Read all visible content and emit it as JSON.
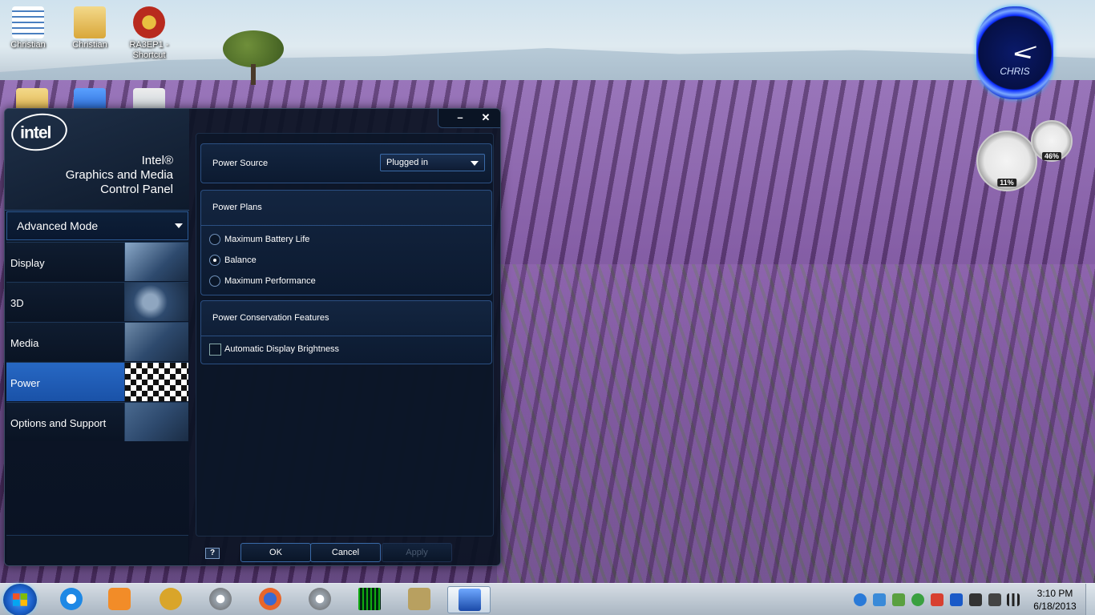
{
  "desktop": {
    "icons": [
      {
        "label": "Christian",
        "color": "#4a7fc0"
      },
      {
        "label": "Christian",
        "color": "#e8c660"
      },
      {
        "label": "RA3EP1 - Shortcut",
        "color": "#b82a1e"
      }
    ]
  },
  "gadgets": {
    "clock_name": "CHRIS",
    "cpu_percent": "11%",
    "mem_percent": "46%"
  },
  "window": {
    "brand": {
      "logo_text": "intel",
      "title_line1": "Intel®",
      "title_line2": "Graphics and Media",
      "title_line3": "Control Panel"
    },
    "mode": "Advanced Mode",
    "nav": [
      {
        "label": "Display",
        "active": false
      },
      {
        "label": "3D",
        "active": false
      },
      {
        "label": "Media",
        "active": false
      },
      {
        "label": "Power",
        "active": true
      },
      {
        "label": "Options and Support",
        "active": false
      }
    ],
    "titlebar": {
      "minimize": "–",
      "close": "✕"
    },
    "power_source": {
      "label": "Power Source",
      "value": "Plugged in"
    },
    "power_plans": {
      "heading": "Power Plans",
      "options": [
        {
          "label": "Maximum Battery Life",
          "selected": false
        },
        {
          "label": "Balance",
          "selected": true
        },
        {
          "label": "Maximum Performance",
          "selected": false
        }
      ]
    },
    "conservation": {
      "heading": "Power Conservation Features",
      "auto_brightness": {
        "label": "Automatic Display Brightness",
        "checked": false
      }
    },
    "footer": {
      "help": "?",
      "ok": "OK",
      "cancel": "Cancel",
      "apply": "Apply"
    }
  },
  "taskbar": {
    "time": "3:10 PM",
    "date": "6/18/2013",
    "apps": [
      {
        "name": "internet-explorer",
        "color": "#1e88e5"
      },
      {
        "name": "media-player",
        "color": "#f28c28"
      },
      {
        "name": "tool-app",
        "color": "#d9a52a"
      },
      {
        "name": "settings-gear",
        "color": "#9aa4ae"
      },
      {
        "name": "firefox",
        "color": "#e8662a"
      },
      {
        "name": "settings-gear-2",
        "color": "#9aa4ae"
      },
      {
        "name": "matrix-app",
        "color": "#0b3a0b"
      },
      {
        "name": "shp-app",
        "color": "#b8a060"
      },
      {
        "name": "intel-graphics",
        "color": "#2a6ad0"
      }
    ]
  }
}
